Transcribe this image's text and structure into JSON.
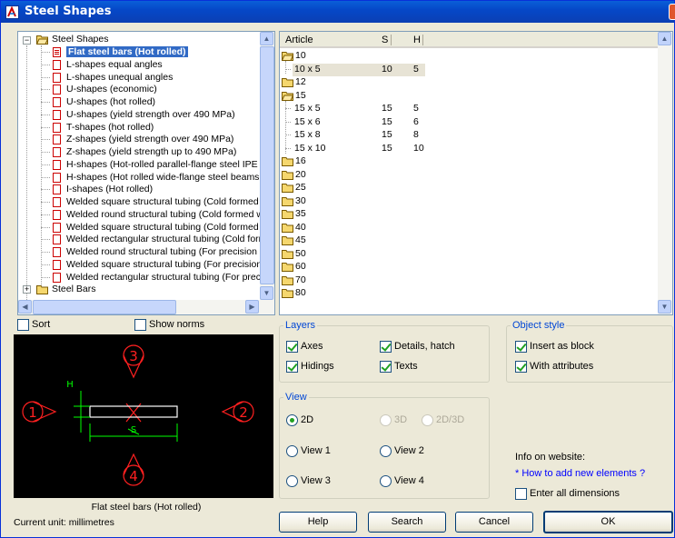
{
  "window": {
    "title": "Steel Shapes"
  },
  "tree": {
    "root_label": "Steel Shapes",
    "items": [
      {
        "label": "Flat steel bars (Hot rolled)",
        "selected": true
      },
      {
        "label": "L-shapes equal angles"
      },
      {
        "label": "L-shapes unequal angles"
      },
      {
        "label": "U-shapes (economic)"
      },
      {
        "label": "U-shapes (hot rolled)"
      },
      {
        "label": "U-shapes (yield strength over 490 MPa)"
      },
      {
        "label": "T-shapes (hot rolled)"
      },
      {
        "label": "Z-shapes (yield strength over 490 MPa)"
      },
      {
        "label": "Z-shapes (yield strength up to 490 MPa)"
      },
      {
        "label": "H-shapes (Hot-rolled parallel-flange steel IPE - Dir"
      },
      {
        "label": "H-shapes (Hot rolled wide-flange steel beams - Di"
      },
      {
        "label": "I-shapes (Hot rolled)"
      },
      {
        "label": "Welded square structural tubing (Cold formed wel"
      },
      {
        "label": "Welded round structural tubing (Cold formed welc"
      },
      {
        "label": "Welded square structural tubing (Cold formed wel"
      },
      {
        "label": "Welded rectangular structural tubing (Cold formec"
      },
      {
        "label": "Welded round structural tubing (For precision app"
      },
      {
        "label": "Welded square structural tubing (For precision ap"
      },
      {
        "label": "Welded rectangular structural tubing (For precisio"
      }
    ],
    "next_root_label": "Steel Bars"
  },
  "list": {
    "columns": {
      "article": "Article",
      "s": "S",
      "h": "H"
    },
    "rows": [
      {
        "type": "folder",
        "label": "10",
        "open": true
      },
      {
        "type": "item",
        "label": "10 x 5",
        "s": "10",
        "h": "5",
        "selected": true
      },
      {
        "type": "folder",
        "label": "12"
      },
      {
        "type": "folder",
        "label": "15",
        "open": true
      },
      {
        "type": "item",
        "label": "15 x 5",
        "s": "15",
        "h": "5"
      },
      {
        "type": "item",
        "label": "15 x 6",
        "s": "15",
        "h": "6"
      },
      {
        "type": "item",
        "label": "15 x 8",
        "s": "15",
        "h": "8"
      },
      {
        "type": "item",
        "label": "15 x 10",
        "s": "15",
        "h": "10"
      },
      {
        "type": "folder",
        "label": "16"
      },
      {
        "type": "folder",
        "label": "20"
      },
      {
        "type": "folder",
        "label": "25"
      },
      {
        "type": "folder",
        "label": "30"
      },
      {
        "type": "folder",
        "label": "35"
      },
      {
        "type": "folder",
        "label": "40"
      },
      {
        "type": "folder",
        "label": "45"
      },
      {
        "type": "folder",
        "label": "50"
      },
      {
        "type": "folder",
        "label": "60"
      },
      {
        "type": "folder",
        "label": "70"
      },
      {
        "type": "folder",
        "label": "80"
      }
    ]
  },
  "options": {
    "sort": {
      "label": "Sort",
      "checked": false
    },
    "show_norms": {
      "label": "Show norms",
      "checked": false
    }
  },
  "preview": {
    "caption": "Flat steel bars (Hot rolled)",
    "views": [
      "1",
      "2",
      "3",
      "4"
    ],
    "dim_h": "H",
    "dim_s": "S"
  },
  "status": {
    "current_unit": "Current unit: millimetres"
  },
  "layers": {
    "title": "Layers",
    "axes": {
      "label": "Axes",
      "checked": true
    },
    "details": {
      "label": "Details, hatch",
      "checked": true
    },
    "hidings": {
      "label": "Hidings",
      "checked": true
    },
    "texts": {
      "label": "Texts",
      "checked": true
    }
  },
  "object_style": {
    "title": "Object style",
    "insert_block": {
      "label": "Insert as block",
      "checked": true
    },
    "attributes": {
      "label": "With attributes",
      "checked": true
    }
  },
  "view": {
    "title": "View",
    "opt_2d": "2D",
    "opt_3d": "3D",
    "opt_2d3d": "2D/3D",
    "view1": "View 1",
    "view2": "View 2",
    "view3": "View 3",
    "view4": "View 4",
    "selected": "2D"
  },
  "info": {
    "label": "Info on website:",
    "link": "* How to add new elements ?",
    "enter_dims": {
      "label": "Enter all dimensions",
      "checked": false
    }
  },
  "buttons": {
    "help": "Help",
    "search": "Search",
    "cancel": "Cancel",
    "ok": "OK"
  },
  "colors": {
    "accent": "#316ac5",
    "title_bar": "#0a5fd8",
    "preview_bg": "#000000",
    "preview_red": "#ff2020",
    "preview_green": "#00ff00",
    "preview_white": "#ffffff"
  }
}
